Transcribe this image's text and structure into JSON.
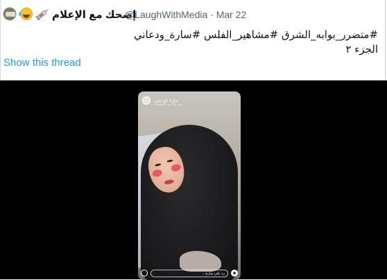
{
  "tweet": {
    "display_name": "إضحك مع الإعلام",
    "emojis": [
      "rolling-laughing-emoji",
      "syringe-emoji"
    ],
    "handle": "@LaughWithMedia",
    "separator": "·",
    "date": "Mar 22",
    "text_line1": "#متضرر_بوابه_الشرق #مشاهير_الفلس #سارة_ودعاني",
    "text_line2": "الجزء ٢",
    "show_thread_label": "Show this thread"
  },
  "media": {
    "type": "video",
    "story": {
      "user": "سارة الودعاني",
      "time": "منذ ٢٥ من الساعات",
      "caption": "سارة الودعاني",
      "reply_placeholder": "رد على سارة..."
    }
  },
  "colors": {
    "link": "#1d9bf0",
    "text_primary": "#0f1419",
    "text_secondary": "#536471",
    "media_bg": "#000000",
    "border": "#cfd9de"
  }
}
